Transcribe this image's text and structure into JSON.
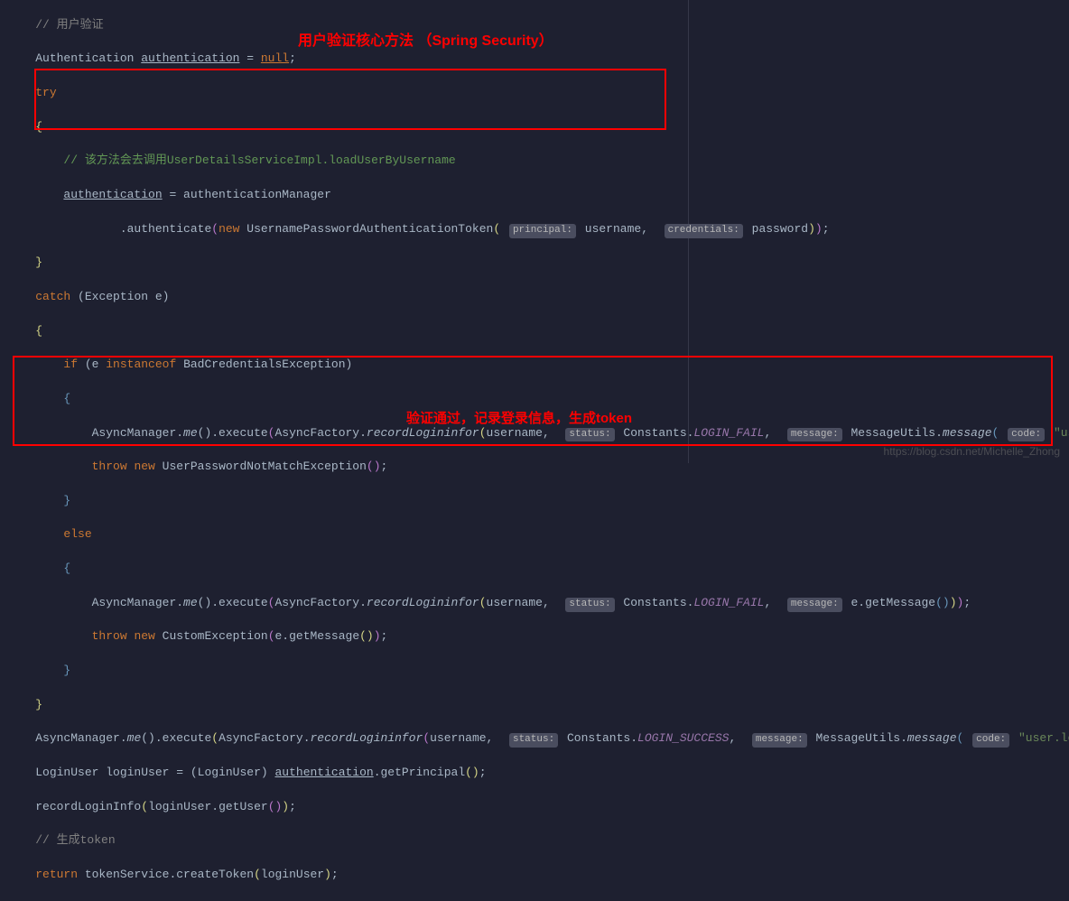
{
  "annotations": {
    "title1": "用户验证核心方法 （Spring Security）",
    "title2": "验证通过，记录登录信息，生成token"
  },
  "watermark": "https://blog.csdn.net/Michelle_Zhong",
  "code": {
    "c1": "// 用户验证",
    "c2_a": "Authentication ",
    "c2_b": "authentication",
    "c2_c": " = ",
    "c2_d": "null",
    "c2_e": ";",
    "c3": "try",
    "c4": "{",
    "c5": "// 该方法会去调用UserDetailsServiceImpl.loadUserByUsername",
    "c6_a": "authentication",
    "c6_b": " = authenticationManager",
    "c7_a": ".authenticate",
    "c7_b": "new",
    "c7_c": " UsernamePasswordAuthenticationToken",
    "c7_h1": "principal:",
    "c7_d": "username, ",
    "c7_h2": "credentials:",
    "c7_e": "password",
    "c8": "}",
    "c9_a": "catch",
    "c9_b": " (Exception e)",
    "c10": "{",
    "c11_a": "if",
    "c11_b": " (e ",
    "c11_c": "instanceof",
    "c11_d": " BadCredentialsException)",
    "c12": "{",
    "c13_a": "AsyncManager.",
    "c13_b": "me",
    "c13_c": "().execute",
    "c13_d": "AsyncFactory.",
    "c13_e": "recordLogininfor",
    "c13_f": "username, ",
    "c13_h1": "status:",
    "c13_g": "Constants.",
    "c13_h": "LOGIN_FAIL",
    "c13_i": ", ",
    "c13_hm": "message:",
    "c13_j": "MessageUtils.",
    "c13_k": "message",
    "c13_hc": "code:",
    "c13_l": "\"user.password.not.match\"",
    "c13_m": "));",
    "c14_a": "throw",
    "c14_b": " new",
    "c14_c": " UserPasswordNotMatchException",
    "c15": "}",
    "c16": "else",
    "c17": "{",
    "c18_l": "\"user.login.success\"",
    "c19_a": "e.getMessage",
    "c20_a": "throw",
    "c20_b": " new",
    "c20_c": " CustomException",
    "c20_d": "e.getMessage",
    "c21": "}",
    "c22": "}",
    "s1_const": "LOGIN_SUCCESS",
    "s2_a": "LoginUser loginUser = ",
    "s2_b": "(LoginUser) ",
    "s2_c": "authentication",
    "s2_d": ".getPrincipal",
    "s3_a": "recordLoginInfo",
    "s3_b": "loginUser.getUser",
    "s4": "// 生成token",
    "s5_a": "return",
    "s5_b": " tokenService.createToken",
    "s5_c": "loginUser"
  }
}
